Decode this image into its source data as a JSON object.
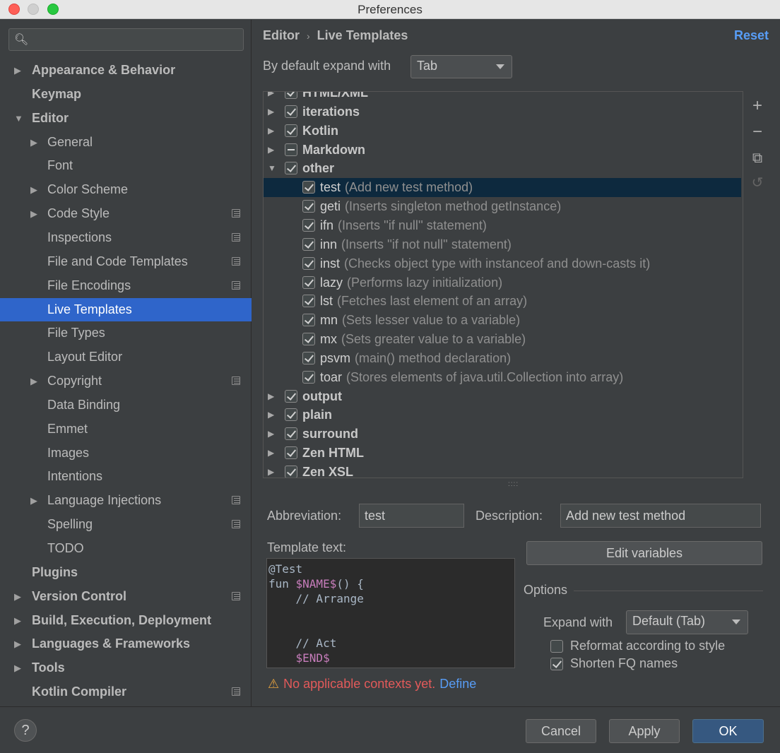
{
  "window": {
    "title": "Preferences"
  },
  "sidebar": {
    "search_placeholder": "",
    "items": [
      {
        "label": "Appearance & Behavior",
        "bold": true,
        "arrow": "▶",
        "level": 0
      },
      {
        "label": "Keymap",
        "bold": true,
        "arrow": "",
        "level": 0
      },
      {
        "label": "Editor",
        "bold": true,
        "arrow": "▼",
        "level": 0
      },
      {
        "label": "General",
        "arrow": "▶",
        "level": 1
      },
      {
        "label": "Font",
        "arrow": "",
        "level": 1
      },
      {
        "label": "Color Scheme",
        "arrow": "▶",
        "level": 1
      },
      {
        "label": "Code Style",
        "arrow": "▶",
        "level": 1,
        "project": true
      },
      {
        "label": "Inspections",
        "arrow": "",
        "level": 1,
        "project": true
      },
      {
        "label": "File and Code Templates",
        "arrow": "",
        "level": 1,
        "project": true
      },
      {
        "label": "File Encodings",
        "arrow": "",
        "level": 1,
        "project": true
      },
      {
        "label": "Live Templates",
        "arrow": "",
        "level": 1,
        "selected": true
      },
      {
        "label": "File Types",
        "arrow": "",
        "level": 1
      },
      {
        "label": "Layout Editor",
        "arrow": "",
        "level": 1
      },
      {
        "label": "Copyright",
        "arrow": "▶",
        "level": 1,
        "project": true
      },
      {
        "label": "Data Binding",
        "arrow": "",
        "level": 1
      },
      {
        "label": "Emmet",
        "arrow": "",
        "level": 1
      },
      {
        "label": "Images",
        "arrow": "",
        "level": 1
      },
      {
        "label": "Intentions",
        "arrow": "",
        "level": 1
      },
      {
        "label": "Language Injections",
        "arrow": "▶",
        "level": 1,
        "project": true
      },
      {
        "label": "Spelling",
        "arrow": "",
        "level": 1,
        "project": true
      },
      {
        "label": "TODO",
        "arrow": "",
        "level": 1
      },
      {
        "label": "Plugins",
        "bold": true,
        "arrow": "",
        "level": 0
      },
      {
        "label": "Version Control",
        "bold": true,
        "arrow": "▶",
        "level": 0,
        "project": true
      },
      {
        "label": "Build, Execution, Deployment",
        "bold": true,
        "arrow": "▶",
        "level": 0
      },
      {
        "label": "Languages & Frameworks",
        "bold": true,
        "arrow": "▶",
        "level": 0
      },
      {
        "label": "Tools",
        "bold": true,
        "arrow": "▶",
        "level": 0
      },
      {
        "label": "Kotlin Compiler",
        "bold": true,
        "arrow": "",
        "level": 0,
        "project": true
      }
    ]
  },
  "header": {
    "breadcrumb_root": "Editor",
    "breadcrumb_separator": "›",
    "breadcrumb_current": "Live Templates",
    "reset_label": "Reset"
  },
  "expand": {
    "label": "By default expand with",
    "value": "Tab"
  },
  "tree": {
    "rows": [
      {
        "type": "group",
        "name": "HTML/XML",
        "state": "checked",
        "arrow": "▶"
      },
      {
        "type": "group",
        "name": "iterations",
        "state": "checked",
        "arrow": "▶"
      },
      {
        "type": "group",
        "name": "Kotlin",
        "state": "checked",
        "arrow": "▶"
      },
      {
        "type": "group",
        "name": "Markdown",
        "state": "mixed",
        "arrow": "▶"
      },
      {
        "type": "group",
        "name": "other",
        "state": "checked",
        "arrow": "▼"
      },
      {
        "type": "item",
        "abbr": "test",
        "desc": "(Add new test method)",
        "selected": true
      },
      {
        "type": "item",
        "abbr": "geti",
        "desc": "(Inserts singleton method getInstance)"
      },
      {
        "type": "item",
        "abbr": "ifn",
        "desc": "(Inserts ''if null'' statement)"
      },
      {
        "type": "item",
        "abbr": "inn",
        "desc": "(Inserts ''if not null'' statement)"
      },
      {
        "type": "item",
        "abbr": "inst",
        "desc": "(Checks object type with instanceof and down-casts it)"
      },
      {
        "type": "item",
        "abbr": "lazy",
        "desc": "(Performs lazy initialization)"
      },
      {
        "type": "item",
        "abbr": "lst",
        "desc": "(Fetches last element of an array)"
      },
      {
        "type": "item",
        "abbr": "mn",
        "desc": "(Sets lesser value to a variable)"
      },
      {
        "type": "item",
        "abbr": "mx",
        "desc": "(Sets greater value to a variable)"
      },
      {
        "type": "item",
        "abbr": "psvm",
        "desc": "(main() method declaration)"
      },
      {
        "type": "item",
        "abbr": "toar",
        "desc": "(Stores elements of java.util.Collection into array)"
      },
      {
        "type": "group",
        "name": "output",
        "state": "checked",
        "arrow": "▶"
      },
      {
        "type": "group",
        "name": "plain",
        "state": "checked",
        "arrow": "▶"
      },
      {
        "type": "group",
        "name": "surround",
        "state": "checked",
        "arrow": "▶"
      },
      {
        "type": "group",
        "name": "Zen HTML",
        "state": "checked",
        "arrow": "▶"
      },
      {
        "type": "group",
        "name": "Zen XSL",
        "state": "checked",
        "arrow": "▶"
      }
    ]
  },
  "toolbar": {
    "add_icon": "+",
    "remove_icon": "−",
    "copy_icon": "⧉",
    "restore_icon": "↺"
  },
  "editor": {
    "abbreviation_label": "Abbreviation:",
    "abbreviation_value": "test",
    "description_label": "Description:",
    "description_value": "Add new test method",
    "template_text_label": "Template text:",
    "template_lines": [
      [
        {
          "t": "@Test"
        }
      ],
      [
        {
          "t": "fun "
        },
        {
          "t": "$NAME$",
          "var": true
        },
        {
          "t": "() {"
        }
      ],
      [
        {
          "t": "    // Arrange"
        }
      ],
      [
        {
          "t": ""
        }
      ],
      [
        {
          "t": ""
        }
      ],
      [
        {
          "t": "    // Act"
        }
      ],
      [
        {
          "t": "    "
        },
        {
          "t": "$END$",
          "var": true
        }
      ]
    ],
    "edit_variables_label": "Edit variables",
    "options_title": "Options",
    "expand_with_label": "Expand with",
    "expand_with_value": "Default (Tab)",
    "reformat_label": "Reformat according to style",
    "reformat_checked": false,
    "shorten_label": "Shorten FQ names",
    "shorten_checked": true,
    "warning_icon": "⚠",
    "warning_text": "No applicable contexts yet.",
    "warning_link": "Define"
  },
  "footer": {
    "help_label": "?",
    "cancel_label": "Cancel",
    "apply_label": "Apply",
    "ok_label": "OK"
  },
  "colors": {
    "selection": "#2f65ca",
    "tree_selection": "#0d293e",
    "link": "#589df6",
    "warning": "#e35a5a",
    "template_var": "#c77dbb"
  }
}
